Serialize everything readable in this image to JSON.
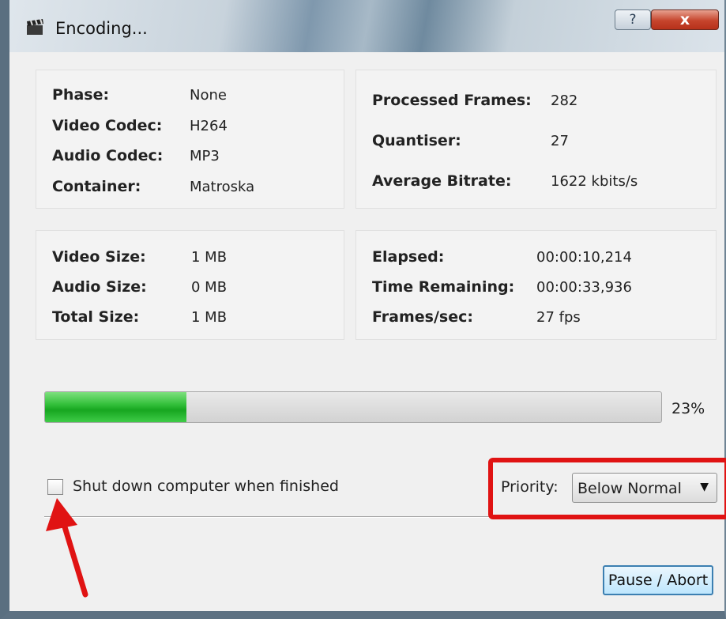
{
  "window": {
    "title": "Encoding...",
    "help_label": "?",
    "close_label": "x"
  },
  "info": {
    "phase_label": "Phase:",
    "phase_value": "None",
    "video_codec_label": "Video Codec:",
    "video_codec_value": "H264",
    "audio_codec_label": "Audio Codec:",
    "audio_codec_value": "MP3",
    "container_label": "Container:",
    "container_value": "Matroska"
  },
  "stats": {
    "processed_frames_label": "Processed Frames:",
    "processed_frames_value": "282",
    "quantiser_label": "Quantiser:",
    "quantiser_value": "27",
    "avg_bitrate_label": "Average Bitrate:",
    "avg_bitrate_value": "1622 kbits/s"
  },
  "sizes": {
    "video_size_label": "Video Size:",
    "video_size_value": "1 MB",
    "audio_size_label": "Audio Size:",
    "audio_size_value": "0 MB",
    "total_size_label": "Total Size:",
    "total_size_value": "1 MB"
  },
  "timing": {
    "elapsed_label": "Elapsed:",
    "elapsed_value": "00:00:10,214",
    "remaining_label": "Time Remaining:",
    "remaining_value": "00:00:33,936",
    "fps_label": "Frames/sec:",
    "fps_value": "27 fps"
  },
  "progress": {
    "percent": 23,
    "percent_text": "23%"
  },
  "options": {
    "shutdown_label": "Shut down computer when finished",
    "shutdown_checked": false,
    "priority_label": "Priority:",
    "priority_value": "Below Normal"
  },
  "actions": {
    "pause_abort_label": "Pause / Abort"
  },
  "colors": {
    "progress_green": "#17a620",
    "highlight_red": "#e01313",
    "arrow_red": "#e01313"
  },
  "icons": {
    "app": "clapperboard-icon",
    "help": "help-icon",
    "close": "close-icon",
    "dropdown": "chevron-down-icon",
    "annotation": "red-arrow-icon"
  }
}
